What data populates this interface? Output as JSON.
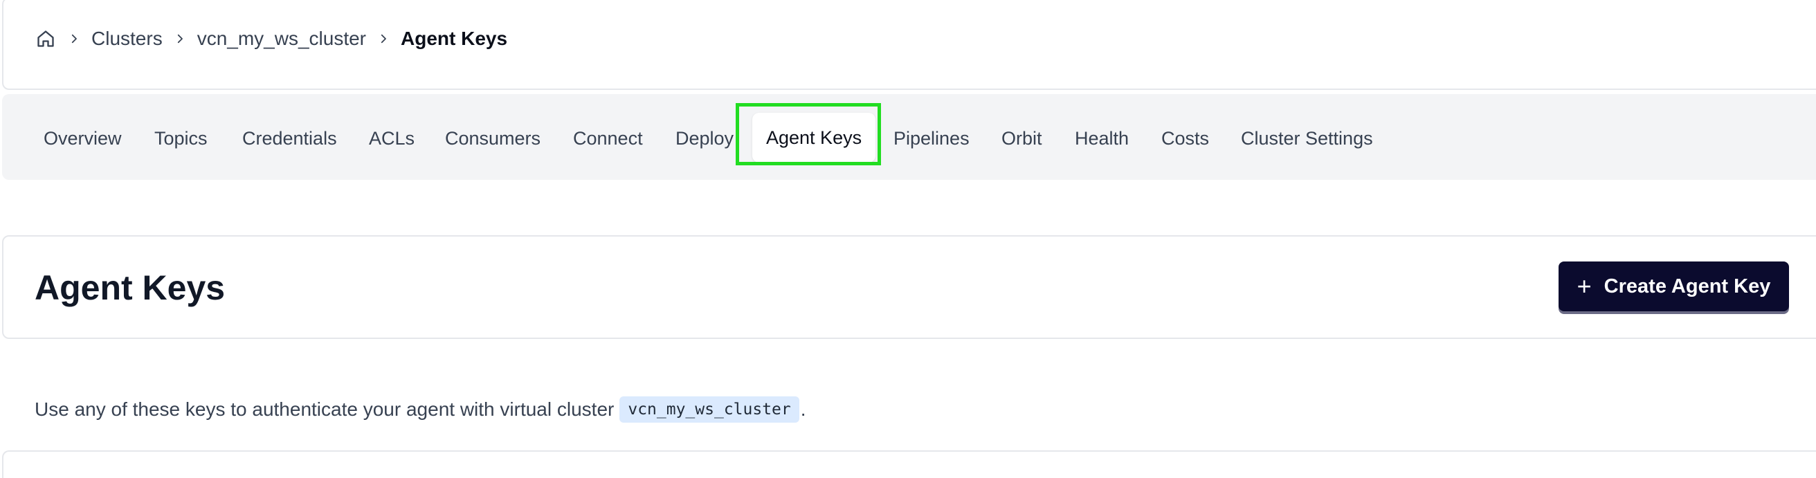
{
  "breadcrumb": {
    "home_icon": "home-icon",
    "items": [
      "Clusters",
      "vcn_my_ws_cluster"
    ],
    "current": "Agent Keys"
  },
  "tabs": {
    "items": [
      {
        "label": "Overview"
      },
      {
        "label": "Topics"
      },
      {
        "label": "Credentials"
      },
      {
        "label": "ACLs"
      },
      {
        "label": "Consumers"
      },
      {
        "label": "Connect"
      },
      {
        "label": "Deploy"
      },
      {
        "label": "Agent Keys",
        "active": true
      },
      {
        "label": "Pipelines"
      },
      {
        "label": "Orbit"
      },
      {
        "label": "Health"
      },
      {
        "label": "Costs"
      },
      {
        "label": "Cluster Settings"
      }
    ]
  },
  "header": {
    "title": "Agent Keys",
    "create_button_label": "Create Agent Key",
    "create_button_icon": "plus-icon"
  },
  "description": {
    "text": "Use any of these keys to authenticate your agent with virtual cluster",
    "cluster": "vcn_my_ws_cluster",
    "suffix": "."
  },
  "colors": {
    "primary_button": "#0b0b2e",
    "highlight": "#22dd22",
    "tab_bar": "#f3f4f6",
    "code_chip": "#dbeafe"
  }
}
